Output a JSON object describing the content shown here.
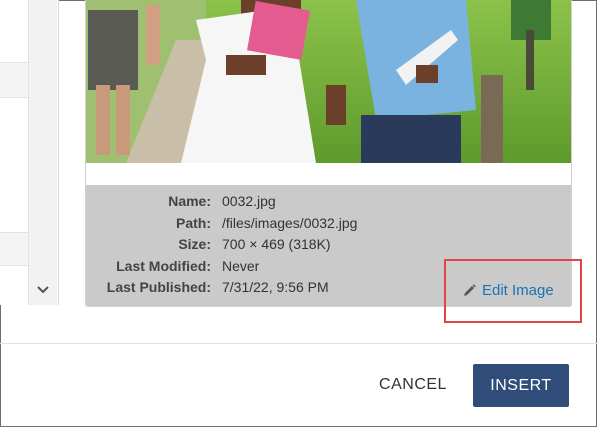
{
  "preview": {
    "image_alt": "Two students walking on campus",
    "details": [
      {
        "label": "Name:",
        "value": "0032.jpg"
      },
      {
        "label": "Path:",
        "value": "/files/images/0032.jpg"
      },
      {
        "label": "Size:",
        "value": "700 × 469 (318K)"
      },
      {
        "label": "Last Modified:",
        "value": "Never"
      },
      {
        "label": "Last Published:",
        "value": "7/31/22, 9:56 PM"
      }
    ],
    "edit_label": "Edit Image",
    "edit_icon": "pencil-icon"
  },
  "footer": {
    "cancel_label": "CANCEL",
    "insert_label": "INSERT"
  },
  "colors": {
    "insert_button": "#2f4d78",
    "link": "#1a73b8",
    "highlight": "#e0454a",
    "info_panel": "#cacaca"
  }
}
